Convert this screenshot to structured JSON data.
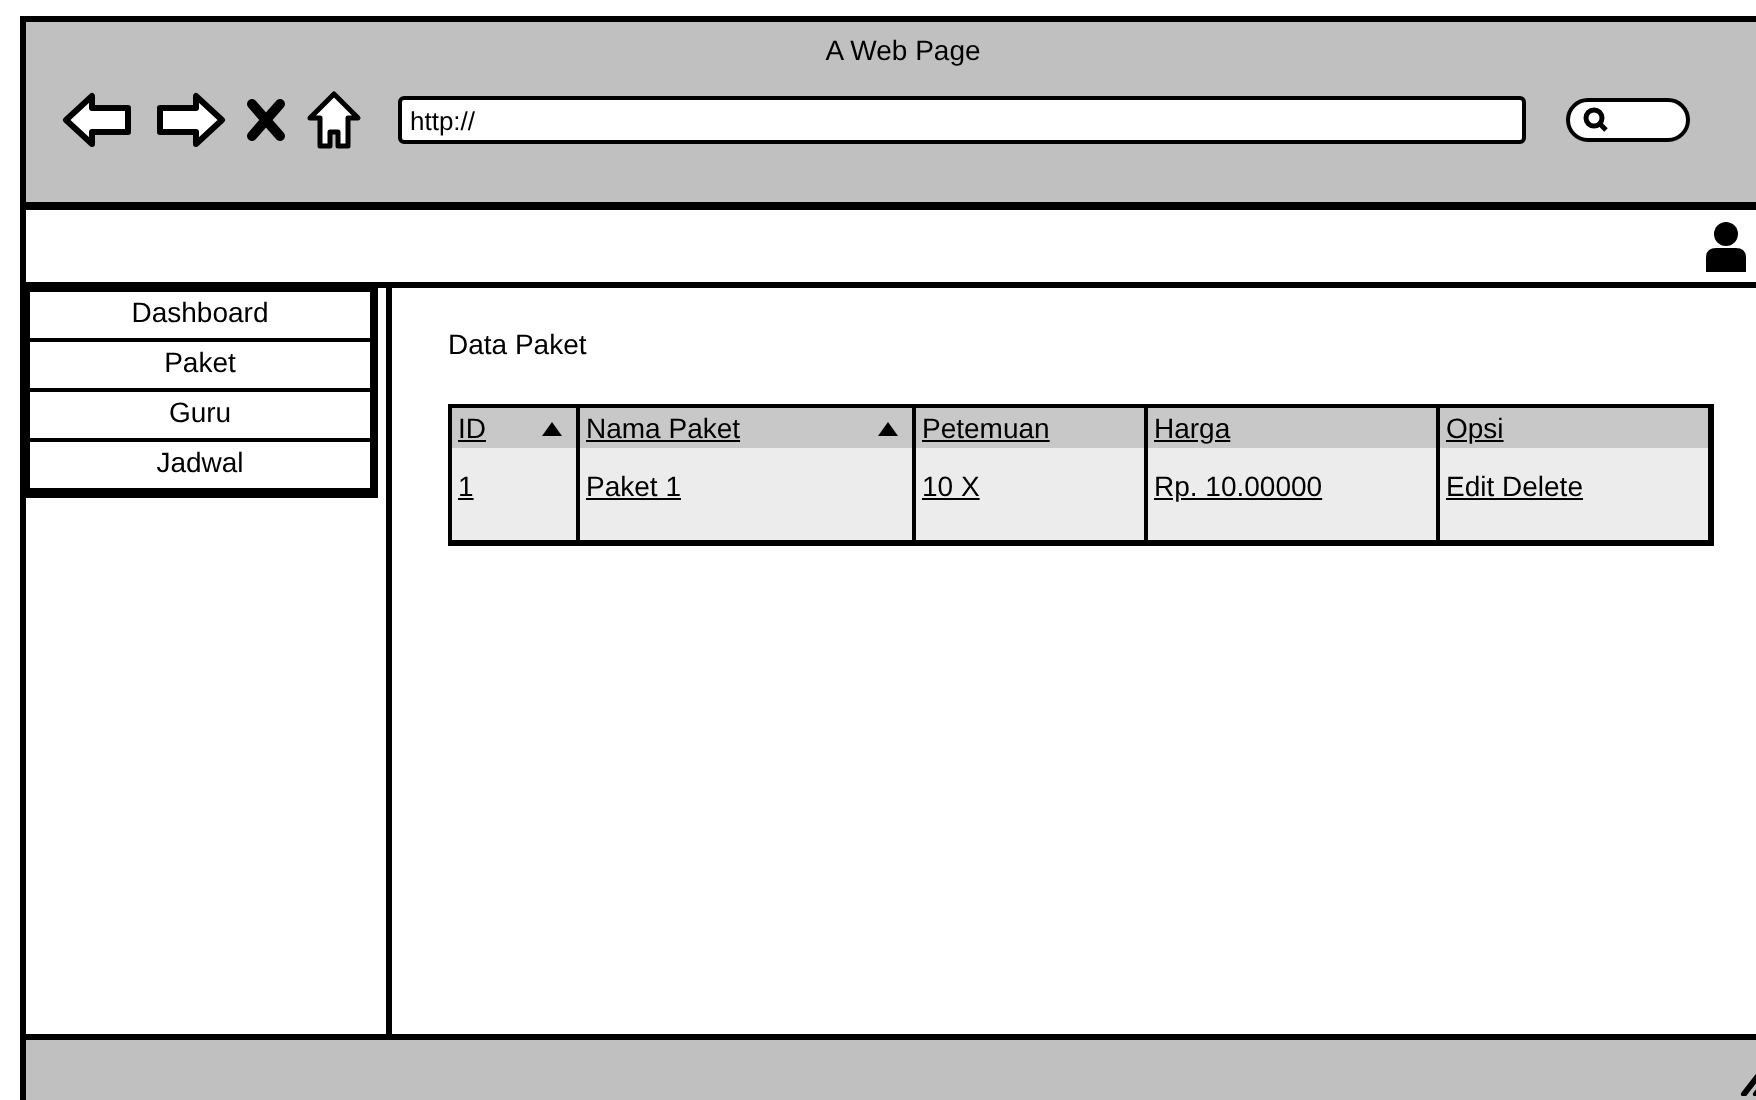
{
  "window": {
    "title": "A Web Page"
  },
  "browser": {
    "address": "http://"
  },
  "sidebar": {
    "items": [
      {
        "label": "Dashboard"
      },
      {
        "label": "Paket"
      },
      {
        "label": "Guru"
      },
      {
        "label": "Jadwal"
      }
    ]
  },
  "content": {
    "heading": "Data Paket",
    "table": {
      "columns": [
        {
          "label": "ID",
          "sorted": true
        },
        {
          "label": "Nama Paket",
          "sorted": true
        },
        {
          "label": "Petemuan",
          "sorted": false
        },
        {
          "label": "Harga",
          "sorted": false
        },
        {
          "label": "Opsi",
          "sorted": false
        }
      ],
      "rows": [
        [
          "1",
          "Paket 1",
          "10 X",
          "Rp. 10.00000",
          "Edit Delete"
        ]
      ]
    }
  }
}
